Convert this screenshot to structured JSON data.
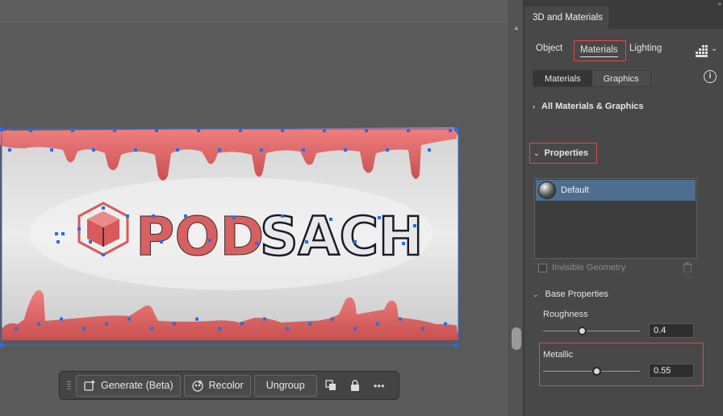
{
  "panel": {
    "title": "3D and Materials",
    "tabs": {
      "object": "Object",
      "materials": "Materials",
      "lighting": "Lighting"
    },
    "segments": {
      "materials": "Materials",
      "graphics": "Graphics"
    },
    "info": "i",
    "all_materials": "All Materials & Graphics",
    "properties": "Properties",
    "selected_material": "Default",
    "invisible_geometry": "Invisible Geometry",
    "base_properties": "Base Properties",
    "roughness": {
      "label": "Roughness",
      "value": "0.4",
      "level": 0.4
    },
    "metallic": {
      "label": "Metallic",
      "value": "0.55",
      "level": 0.55
    }
  },
  "toolbar": {
    "generate": "Generate (Beta)",
    "recolor": "Recolor",
    "ungroup": "Ungroup",
    "more": "•••"
  },
  "artwork": {
    "text_red": "POD",
    "text_dark": "SACH"
  },
  "colors": {
    "accent_highlight": "#e04a4a",
    "selection_blue": "#2a6de0",
    "drip_red": "#e46a6a",
    "selected_row": "#4d6e8f"
  },
  "icons": [
    "generate-icon",
    "recolor-icon",
    "arrange-icon",
    "lock-icon",
    "grid-icon",
    "info-icon",
    "trash-icon",
    "chevron-right-icon",
    "chevron-down-icon"
  ]
}
